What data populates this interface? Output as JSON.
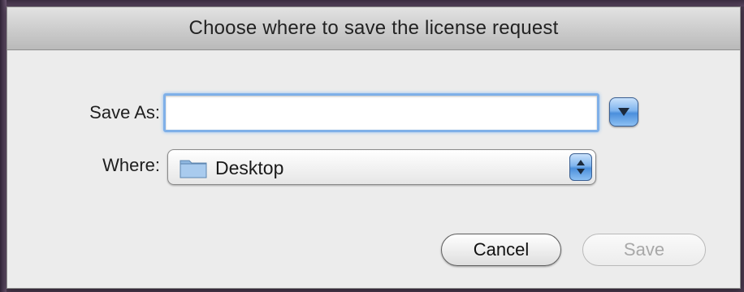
{
  "dialog": {
    "title": "Choose where to save the license request",
    "save_as_label": "Save As:",
    "save_as_value": "",
    "where_label": "Where:",
    "where_value": "Desktop",
    "cancel_label": "Cancel",
    "save_label": "Save",
    "save_enabled": false
  },
  "icons": {
    "expand": "triangle-down-icon",
    "folder": "folder-icon",
    "popup_arrows": "up-down-arrows-icon"
  },
  "colors": {
    "accent_blue": "#4b8fdc",
    "focus_ring": "#7fb0e8",
    "dialog_bg": "#ececec"
  }
}
